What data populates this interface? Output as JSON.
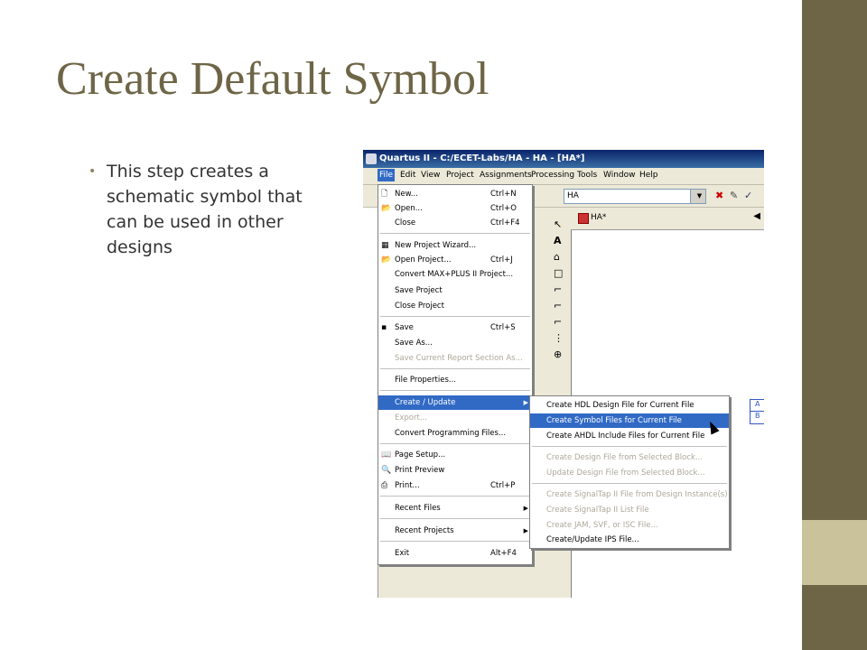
{
  "slide": {
    "title": "Create Default Symbol",
    "bullet": "This step creates a schematic symbol that can be used in other designs",
    "colors": {
      "accent": "#6e6547",
      "accent_light": "#c9c29b"
    }
  },
  "app": {
    "window_title": "Quartus II - C:/ECET-Labs/HA - HA - [HA*]",
    "menus": [
      "File",
      "Edit",
      "View",
      "Project",
      "Assignments",
      "Processing",
      "Tools",
      "Window",
      "Help"
    ],
    "combo_value": "HA",
    "doc_tab": "HA*",
    "block_labels": [
      "A",
      "B"
    ]
  },
  "file_menu": {
    "items": [
      {
        "label": "New...",
        "shortcut": "Ctrl+N",
        "icon": "new-file-icon"
      },
      {
        "label": "Open...",
        "shortcut": "Ctrl+O",
        "icon": "open-folder-icon"
      },
      {
        "label": "Close",
        "shortcut": "Ctrl+F4"
      },
      {
        "label": "New Project Wizard..."
      },
      {
        "label": "Open Project...",
        "shortcut": "Ctrl+J",
        "icon": "open-project-icon"
      },
      {
        "label": "Convert MAX+PLUS II Project..."
      },
      {
        "label": "Save Project"
      },
      {
        "label": "Close Project"
      },
      {
        "label": "Save",
        "shortcut": "Ctrl+S",
        "icon": "save-icon"
      },
      {
        "label": "Save As..."
      },
      {
        "label": "Save Current Report Section As..."
      },
      {
        "label": "File Properties..."
      },
      {
        "label": "Create / Update"
      },
      {
        "label": "Export..."
      },
      {
        "label": "Convert Programming Files..."
      },
      {
        "label": "Page Setup...",
        "icon": "page-setup-icon"
      },
      {
        "label": "Print Preview",
        "icon": "print-preview-icon"
      },
      {
        "label": "Print...",
        "shortcut": "Ctrl+P",
        "icon": "print-icon"
      },
      {
        "label": "Recent Files"
      },
      {
        "label": "Recent Projects"
      },
      {
        "label": "Exit",
        "shortcut": "Alt+F4"
      }
    ]
  },
  "submenu": {
    "items": [
      {
        "label": "Create HDL Design File for Current File"
      },
      {
        "label": "Create Symbol Files for Current File"
      },
      {
        "label": "Create AHDL Include Files for Current File"
      },
      {
        "label": "Create Design File from Selected Block..."
      },
      {
        "label": "Update Design File from Selected Block..."
      },
      {
        "label": "Create SignalTap II File from Design Instance(s)"
      },
      {
        "label": "Create SignalTap II List File"
      },
      {
        "label": "Create JAM, SVF, or ISC File..."
      },
      {
        "label": "Create/Update IPS File..."
      }
    ]
  }
}
